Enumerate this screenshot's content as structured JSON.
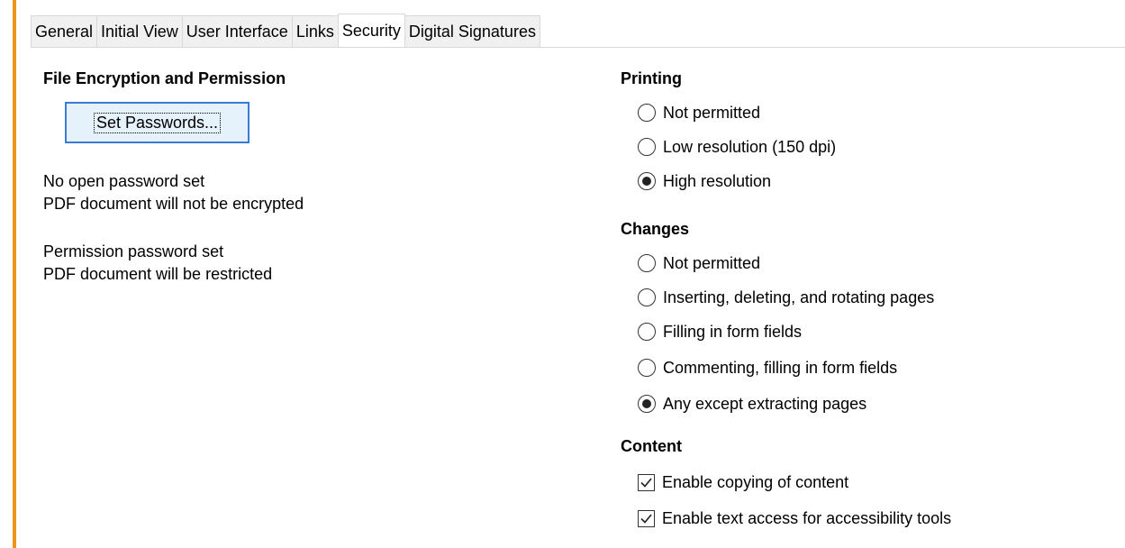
{
  "tabs": [
    {
      "label": "General",
      "active": false
    },
    {
      "label": "Initial View",
      "active": false
    },
    {
      "label": "User Interface",
      "active": false
    },
    {
      "label": "Links",
      "active": false
    },
    {
      "label": "Security",
      "active": true
    },
    {
      "label": "Digital Signatures",
      "active": false
    }
  ],
  "encryption": {
    "title": "File Encryption and Permission",
    "set_passwords_label": "Set Passwords...",
    "open_status_line1": "No open password set",
    "open_status_line2": "PDF document will not be encrypted",
    "permission_status_line1": "Permission password set",
    "permission_status_line2": "PDF document will be restricted"
  },
  "printing": {
    "title": "Printing",
    "options": [
      {
        "label": "Not permitted",
        "selected": false
      },
      {
        "label": "Low resolution (150 dpi)",
        "selected": false
      },
      {
        "label": "High resolution",
        "selected": true
      }
    ]
  },
  "changes": {
    "title": "Changes",
    "options": [
      {
        "label": "Not permitted",
        "selected": false
      },
      {
        "label": "Inserting, deleting, and rotating pages",
        "selected": false
      },
      {
        "label": "Filling in form fields",
        "selected": false
      },
      {
        "label": "Commenting, filling in form fields",
        "selected": false
      },
      {
        "label": "Any except extracting pages",
        "selected": true
      }
    ]
  },
  "content": {
    "title": "Content",
    "options": [
      {
        "label": "Enable copying of content",
        "checked": true
      },
      {
        "label": "Enable text access for accessibility tools",
        "checked": true
      }
    ]
  },
  "colors": {
    "accent": "#f0931c",
    "button_border": "#3a7bd5",
    "button_bg": "#e5f1fb"
  }
}
